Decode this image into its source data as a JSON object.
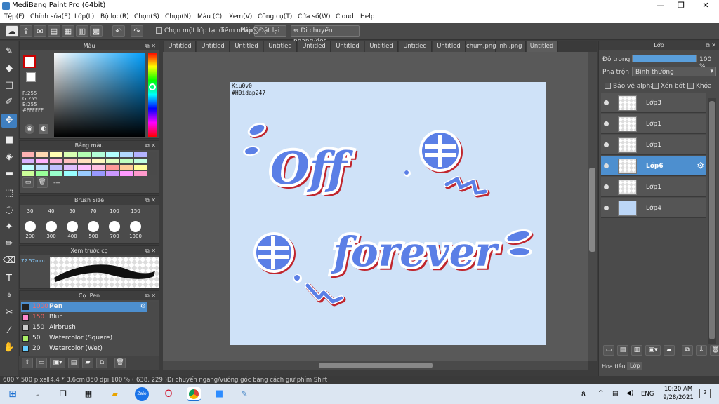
{
  "app": {
    "title": "MediBang Paint Pro (64bit)"
  },
  "window_controls": {
    "minimize": "—",
    "maximize": "❐",
    "close": "✕"
  },
  "menu": [
    "Tệp(F)",
    "Chỉnh sửa(E)",
    "Lớp(L)",
    "Bộ lọc(R)",
    "Chọn(S)",
    "Chụp(N)",
    "Màu (C)",
    "Xem(V)",
    "Công cụ(T)",
    "Cửa sổ(W)",
    "Cloud",
    "Help"
  ],
  "toolbar": {
    "select_one_layer": "Chọn một lớp tại điểm nhấp",
    "key_label": "Phím",
    "reset": "Đặt lại",
    "move_hv": "Di chuyển ngang/dọc"
  },
  "color_panel": {
    "title": "Màu",
    "r": "R:255",
    "g": "G:255",
    "b": "B:255",
    "hex": "#FFFFFF",
    "primary_color": "#cc0000",
    "secondary_color": "#ffffff"
  },
  "palette_panel": {
    "title": "Bảng màu",
    "extra": "---",
    "colors": [
      "#ffb3b3",
      "#ffd9b3",
      "#ffffb3",
      "#d9ffb3",
      "#b3ffb3",
      "#b3ffd9",
      "#b3ffff",
      "#b3d9ff",
      "#b3b3ff",
      "#d9b3ff",
      "#ffb3ff",
      "#ffb3d9",
      "#ffc0c0",
      "#ffe0c0",
      "#fff8c0",
      "#e0ffc0",
      "#c0ffc0",
      "#c0ffe0",
      "#c0ffff",
      "#c0e0ff",
      "#c0c0ff",
      "#e0c0ff",
      "#ffc0ff",
      "#ffc0e0",
      "#ff9999",
      "#ffcc99",
      "#ffff99",
      "#ccff99",
      "#99ff99",
      "#99ffcc",
      "#99ffff",
      "#99ccff",
      "#9999ff",
      "#cc99ff",
      "#ff99ff",
      "#ff99cc"
    ]
  },
  "brush_size_panel": {
    "title": "Brush Size",
    "top_row": [
      "30",
      "40",
      "50",
      "70",
      "100",
      "150"
    ],
    "bottom_row": [
      "200",
      "300",
      "400",
      "500",
      "700",
      "1000"
    ]
  },
  "preview_panel": {
    "title": "Xem trước cọ",
    "size": "72.57mm"
  },
  "brush_panel": {
    "title": "Cọ: Pen",
    "items": [
      {
        "size": "1000",
        "name": "Pen",
        "color": "#222222"
      },
      {
        "size": "150",
        "name": "Blur",
        "color": "#ff88cc"
      },
      {
        "size": "150",
        "name": "Airbrush",
        "color": "#cccccc"
      },
      {
        "size": "50",
        "name": "Watercolor (Square)",
        "color": "#aaee66"
      },
      {
        "size": "20",
        "name": "Watercolor (Wet)",
        "color": "#66ccff"
      }
    ]
  },
  "tabs": [
    "Untitled",
    "Untitled",
    "Untitled",
    "Untitled",
    "Untitled",
    "Untitled",
    "Untitled",
    "Untitled",
    "Untitled",
    "chum.png",
    "nhi.png",
    "Untitled"
  ],
  "canvas": {
    "note_line1": "Kiu0v0",
    "note_line2": "#H0idap247",
    "word1": "Off",
    "word2": "forever"
  },
  "layer_panel": {
    "title": "Lớp",
    "opacity_label": "Độ trong",
    "opacity_value": "100 %",
    "blend_label": "Pha trộn",
    "blend_value": "Bình thường",
    "protect_alpha": "Bảo vệ alpha",
    "clipping": "Xén bớt",
    "lock": "Khóa",
    "layers": [
      "Lớp3",
      "Lớp1",
      "Lớp1",
      "Lớp6",
      "Lớp1",
      "Lớp4"
    ],
    "bottom_tabs": [
      "Hoa tiêu",
      "Lớp"
    ]
  },
  "status": {
    "size": "600 * 500 pixel",
    "dims": "(4.4 * 3.6cm)",
    "dpi": "350 dpi",
    "zoom": "100 %",
    "coords": "( 638, 229 )",
    "hint": "Di chuyển ngang/vuông góc bằng cách giữ phím Shift"
  },
  "taskbar": {
    "time": "10:20 AM",
    "date": "9/28/2021",
    "lang": "ENG",
    "notif": "2"
  }
}
